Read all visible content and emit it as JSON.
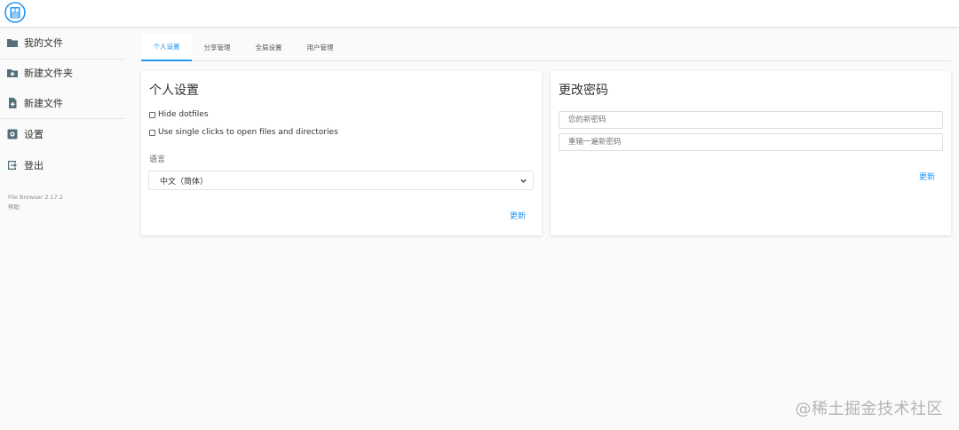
{
  "sidebar": {
    "items": [
      {
        "label": "我的文件",
        "icon": "folder-icon"
      },
      {
        "label": "新建文件夹",
        "icon": "new-folder-icon"
      },
      {
        "label": "新建文件",
        "icon": "new-file-icon"
      },
      {
        "label": "设置",
        "icon": "settings-icon"
      },
      {
        "label": "登出",
        "icon": "logout-icon"
      }
    ],
    "footer": {
      "version": "File Browser 2.17.2",
      "help": "帮助"
    }
  },
  "tabs": [
    {
      "label": "个人设置",
      "active": true
    },
    {
      "label": "分享管理",
      "active": false
    },
    {
      "label": "全局设置",
      "active": false
    },
    {
      "label": "用户管理",
      "active": false
    }
  ],
  "profile": {
    "title": "个人设置",
    "hide_dotfiles": "Hide dotfiles",
    "single_click": "Use single clicks to open files and directories",
    "language_label": "语言",
    "language_value": "中文（简体）",
    "submit": "更新"
  },
  "password": {
    "title": "更改密码",
    "new_placeholder": "您的新密码",
    "confirm_placeholder": "重输一遍新密码",
    "submit": "更新"
  },
  "watermark": "@稀土掘金技术社区",
  "colors": {
    "accent": "#2196f3",
    "icon": "#546e7a"
  }
}
